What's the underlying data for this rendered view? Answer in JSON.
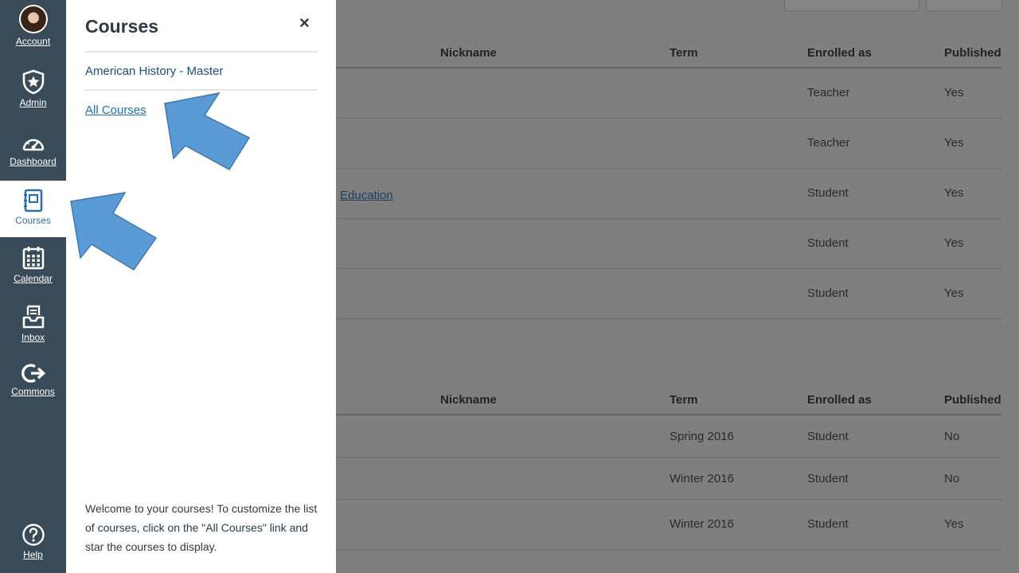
{
  "nav": {
    "account": "Account",
    "admin": "Admin",
    "dashboard": "Dashboard",
    "courses": "Courses",
    "calendar": "Calendar",
    "inbox": "Inbox",
    "commons": "Commons",
    "help": "Help"
  },
  "tray": {
    "title": "Courses",
    "close_symbol": "×",
    "links": [
      "American History - Master",
      "All Courses"
    ],
    "help_text": "Welcome to your courses! To customize the list of courses, click on the \"All Courses\" link and star the courses to display."
  },
  "table1": {
    "headers": {
      "nickname": "Nickname",
      "term": "Term",
      "enrolled": "Enrolled as",
      "published": "Published"
    },
    "partial_link": "Education",
    "rows": [
      {
        "enrolled": "Teacher",
        "published": "Yes"
      },
      {
        "enrolled": "Teacher",
        "published": "Yes"
      },
      {
        "enrolled": "Student",
        "published": "Yes"
      },
      {
        "enrolled": "Student",
        "published": "Yes"
      },
      {
        "enrolled": "Student",
        "published": "Yes"
      }
    ]
  },
  "table2": {
    "headers": {
      "nickname": "Nickname",
      "term": "Term",
      "enrolled": "Enrolled as",
      "published": "Published"
    },
    "rows": [
      {
        "term": "Spring 2016",
        "enrolled": "Student",
        "published": "No"
      },
      {
        "term": "Winter 2016",
        "enrolled": "Student",
        "published": "No"
      },
      {
        "term": "Winter 2016",
        "enrolled": "Student",
        "published": "Yes"
      }
    ]
  },
  "colors": {
    "nav_bg": "#394b58",
    "arrow": "#5b9bd5",
    "link": "#1a4e7a",
    "overlay": "#7f7f7f"
  }
}
